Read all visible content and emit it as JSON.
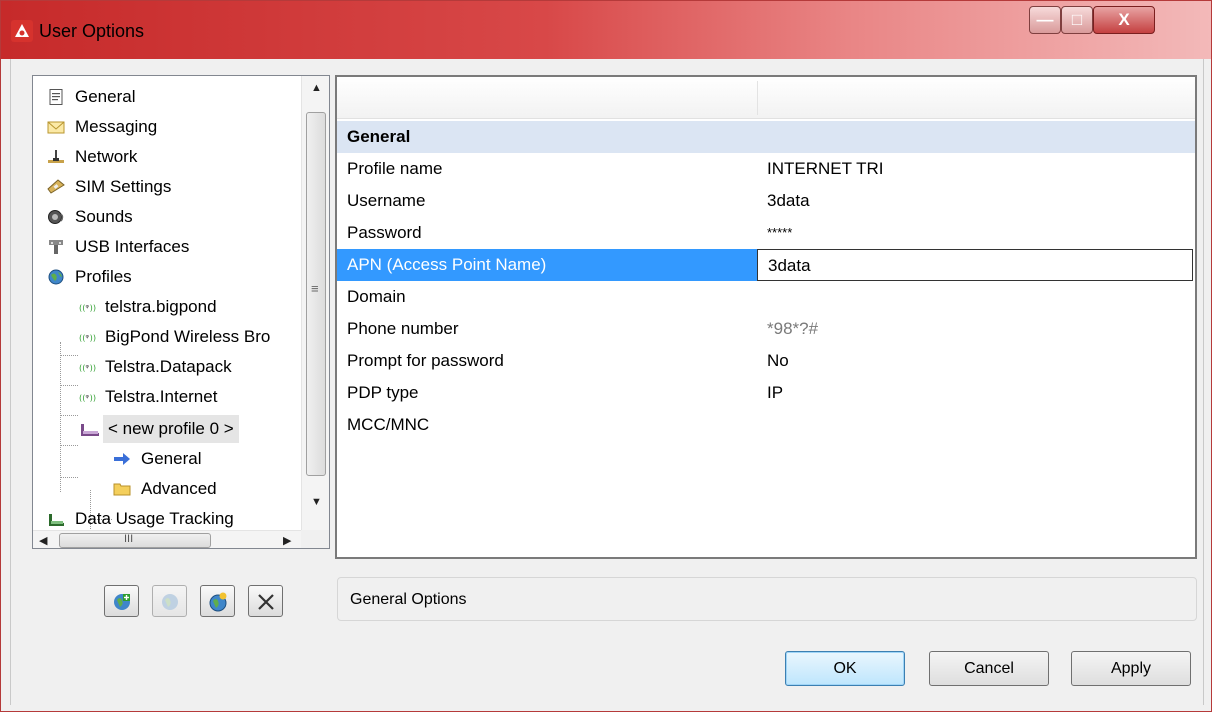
{
  "window": {
    "title": "User Options",
    "minimize_glyph": "—",
    "maximize_glyph": "□",
    "close_glyph": "X"
  },
  "tree": {
    "items": [
      {
        "label": "General",
        "icon": "document-icon"
      },
      {
        "label": "Messaging",
        "icon": "envelope-icon"
      },
      {
        "label": "Network",
        "icon": "network-icon"
      },
      {
        "label": "SIM Settings",
        "icon": "sim-card-icon"
      },
      {
        "label": "Sounds",
        "icon": "speaker-icon"
      },
      {
        "label": "USB Interfaces",
        "icon": "usb-icon"
      },
      {
        "label": "Profiles",
        "icon": "globe-icon"
      },
      {
        "label": "telstra.bigpond",
        "icon": "antenna-icon"
      },
      {
        "label": "BigPond Wireless Bro",
        "icon": "antenna-icon"
      },
      {
        "label": "Telstra.Datapack",
        "icon": "antenna-icon"
      },
      {
        "label": "Telstra.Internet",
        "icon": "antenna-icon"
      },
      {
        "label": "< new profile 0 >",
        "icon": "modem-icon"
      },
      {
        "label": "General",
        "icon": "arrow-right-icon"
      },
      {
        "label": "Advanced",
        "icon": "folder-icon"
      },
      {
        "label": "Data Usage Tracking",
        "icon": "modem-icon"
      }
    ],
    "scroll_grip": "≡",
    "hscroll_grip": "III"
  },
  "toolbar": {
    "buttons": [
      {
        "name": "add-profile",
        "icon": "add-profile-icon",
        "enabled": true
      },
      {
        "name": "copy-profile",
        "icon": "copy-profile-icon",
        "enabled": false
      },
      {
        "name": "new-connection",
        "icon": "globe-add-icon",
        "enabled": true
      },
      {
        "name": "delete",
        "icon": "delete-icon",
        "enabled": true
      }
    ]
  },
  "grid": {
    "section": "General",
    "rows": [
      {
        "name": "Profile name",
        "value": "INTERNET TRI"
      },
      {
        "name": "Username",
        "value": "3data"
      },
      {
        "name": "Password",
        "value": "*****"
      },
      {
        "name": "APN (Access Point Name)",
        "value": "3data",
        "selected": true
      },
      {
        "name": "Domain",
        "value": ""
      },
      {
        "name": "Phone number",
        "value": "*98*?#"
      },
      {
        "name": "Prompt for password",
        "value": "No"
      },
      {
        "name": "PDP type",
        "value": "IP"
      },
      {
        "name": "MCC/MNC",
        "value": ""
      }
    ]
  },
  "description": "General Options",
  "buttons": {
    "ok": "OK",
    "cancel": "Cancel",
    "apply": "Apply"
  },
  "colors": {
    "title_red": "#c62a2a",
    "selection_blue": "#3399ff",
    "section_bg": "#dbe5f3"
  }
}
